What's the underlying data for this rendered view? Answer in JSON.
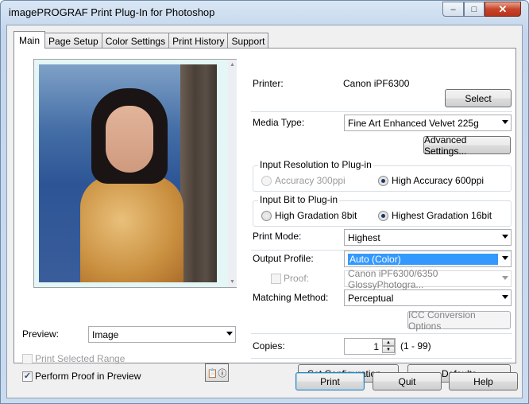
{
  "window": {
    "title": "imagePROGRAF Print Plug-In for Photoshop",
    "min": "–",
    "max": "□",
    "close": "✕"
  },
  "tabs": [
    {
      "label": "Main"
    },
    {
      "label": "Page Setup"
    },
    {
      "label": "Color Settings"
    },
    {
      "label": "Print History"
    },
    {
      "label": "Support"
    }
  ],
  "left": {
    "preview_label": "Preview:",
    "preview_value": "Image",
    "print_selected_range": "Print Selected Range",
    "perform_proof": "Perform Proof in Preview"
  },
  "printer": {
    "label": "Printer:",
    "value": "Canon iPF6300",
    "select_button": "Select"
  },
  "media": {
    "label": "Media Type:",
    "value": "Fine Art Enhanced Velvet 225g",
    "advanced_button": "Advanced Settings..."
  },
  "input_resolution": {
    "title": "Input Resolution to Plug-in",
    "opt1": "Accuracy 300ppi",
    "opt2": "High Accuracy 600ppi"
  },
  "input_bit": {
    "title": "Input Bit to Plug-in",
    "opt1": "High Gradation 8bit",
    "opt2": "Highest Gradation 16bit"
  },
  "print_mode": {
    "label": "Print Mode:",
    "value": "Highest"
  },
  "output_profile": {
    "label": "Output Profile:",
    "value": "Auto (Color)"
  },
  "proof": {
    "label": "Proof:",
    "value": "Canon iPF6300/6350 GlossyPhotogra..."
  },
  "matching": {
    "label": "Matching Method:",
    "value": "Perceptual",
    "icc_button": "ICC Conversion Options"
  },
  "copies": {
    "label": "Copies:",
    "value": "1",
    "range": "(1 - 99)"
  },
  "buttons": {
    "set_config": "Set Configuration...",
    "defaults": "Defaults",
    "print": "Print",
    "quit": "Quit",
    "help": "Help"
  },
  "colors": {
    "accent": "#3399ff",
    "titlebar": "#c9dbef",
    "close": "#c8452a"
  }
}
